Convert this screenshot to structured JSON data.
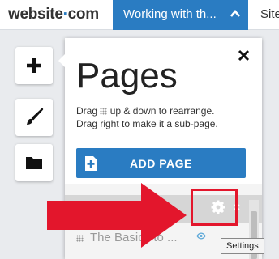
{
  "header": {
    "logo_text": "website",
    "logo_dot": "·",
    "logo_tld": "com",
    "active_menu_label": "Working with th...",
    "next_menu_label": "Site"
  },
  "tools": [
    {
      "icon": "plus-icon"
    },
    {
      "icon": "paintbrush-icon"
    },
    {
      "icon": "folder-icon"
    }
  ],
  "panel": {
    "title": "Pages",
    "help_line1_before": "Drag",
    "help_line1_after": "up & down to rearrange.",
    "help_line2": "Drag right to make it a sub-page.",
    "add_button_label": "ADD PAGE",
    "pages": [
      {
        "label": ""
      },
      {
        "label": "The Basics to ..."
      }
    ]
  },
  "tooltip": {
    "text": "Settings"
  },
  "colors": {
    "accent": "#2a7cc2",
    "highlight_red": "#e3162c"
  }
}
